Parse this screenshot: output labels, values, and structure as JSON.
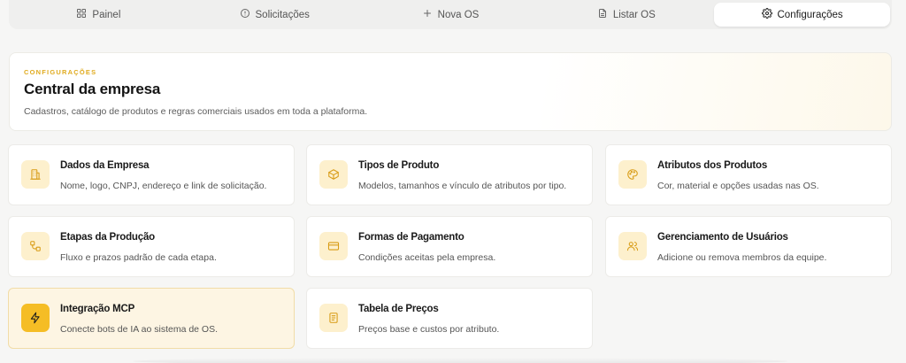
{
  "tabs": [
    {
      "label": "Painel",
      "icon": "grid-icon"
    },
    {
      "label": "Solicitações",
      "icon": "alert-circle-icon"
    },
    {
      "label": "Nova OS",
      "icon": "plus-icon"
    },
    {
      "label": "Listar OS",
      "icon": "document-list-icon"
    },
    {
      "label": "Configurações",
      "icon": "gear-icon",
      "active": true
    }
  ],
  "hero": {
    "eyebrow": "CONFIGURAÇÕES",
    "title": "Central da empresa",
    "subtitle": "Cadastros, catálogo de produtos e regras comerciais usados em toda a plataforma."
  },
  "cards": [
    {
      "title": "Dados da Empresa",
      "description": "Nome, logo, CNPJ, endereço e link de solicitação.",
      "icon": "building-icon"
    },
    {
      "title": "Tipos de Produto",
      "description": "Modelos, tamanhos e vínculo de atributos por tipo.",
      "icon": "box-icon"
    },
    {
      "title": "Atributos dos Produtos",
      "description": "Cor, material e opções usadas nas OS.",
      "icon": "palette-icon"
    },
    {
      "title": "Etapas da Produção",
      "description": "Fluxo e prazos padrão de cada etapa.",
      "icon": "workflow-icon"
    },
    {
      "title": "Formas de Pagamento",
      "description": "Condições aceitas pela empresa.",
      "icon": "credit-card-icon"
    },
    {
      "title": "Gerenciamento de Usuários",
      "description": "Adicione ou remova membros da equipe.",
      "icon": "users-icon"
    },
    {
      "title": "Integração MCP",
      "description": "Conecte bots de IA ao sistema de OS.",
      "icon": "lightning-icon",
      "highlight": true
    },
    {
      "title": "Tabela de Preços",
      "description": "Preços base e custos por atributo.",
      "icon": "receipt-icon"
    }
  ],
  "colors": {
    "accent": "#f5bd25",
    "accent_soft": "#fdf0cd",
    "icon_stroke": "#d89b14",
    "eyebrow": "#e0ab1f"
  }
}
